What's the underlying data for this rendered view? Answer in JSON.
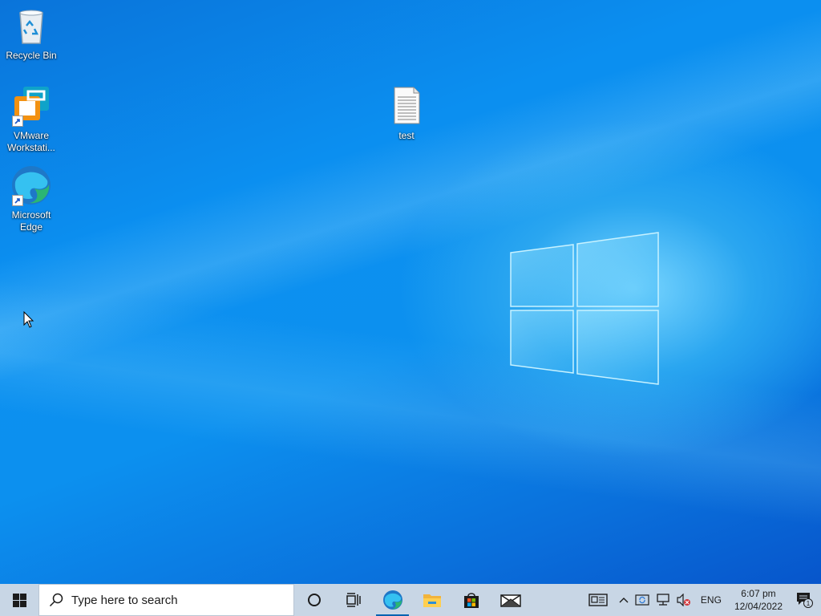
{
  "desktop": {
    "icons": [
      {
        "label": "Recycle Bin",
        "icon": "recycle-bin-icon"
      },
      {
        "label": "VMware Workstati...",
        "icon": "vmware-icon"
      },
      {
        "label": "Microsoft Edge",
        "icon": "edge-icon"
      },
      {
        "label": "test",
        "icon": "text-file-icon"
      }
    ]
  },
  "taskbar": {
    "search_placeholder": "Type here to search",
    "apps": [
      {
        "name": "Cortana",
        "icon": "cortana-icon"
      },
      {
        "name": "Task View",
        "icon": "task-view-icon"
      },
      {
        "name": "Microsoft Edge",
        "icon": "edge-icon",
        "active": true
      },
      {
        "name": "File Explorer",
        "icon": "folder-icon"
      },
      {
        "name": "Microsoft Store",
        "icon": "store-icon"
      },
      {
        "name": "Mail",
        "icon": "mail-icon"
      }
    ],
    "tray": {
      "language": "ENG",
      "time": "6:07 pm",
      "date": "12/04/2022",
      "notification_count": "1"
    }
  },
  "colors": {
    "desktop_blue": "#0b8ff0",
    "taskbar_bg": "#c8d6e5",
    "accent": "#0063b1"
  }
}
